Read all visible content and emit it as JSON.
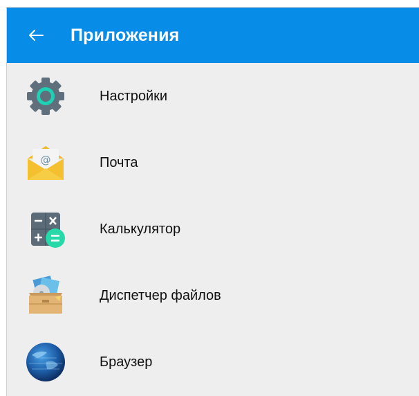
{
  "header": {
    "title": "Приложения",
    "back_icon": "arrow-left-icon",
    "color": "#078ce8"
  },
  "apps": [
    {
      "label": "Настройки",
      "icon": "settings-gear-icon"
    },
    {
      "label": "Почта",
      "icon": "mail-envelope-icon"
    },
    {
      "label": "Калькулятор",
      "icon": "calculator-icon"
    },
    {
      "label": "Диспетчер файлов",
      "icon": "file-manager-box-icon"
    },
    {
      "label": "Браузер",
      "icon": "browser-globe-icon"
    }
  ],
  "colors": {
    "background": "#eeeeee",
    "appbar": "#078ce8"
  }
}
